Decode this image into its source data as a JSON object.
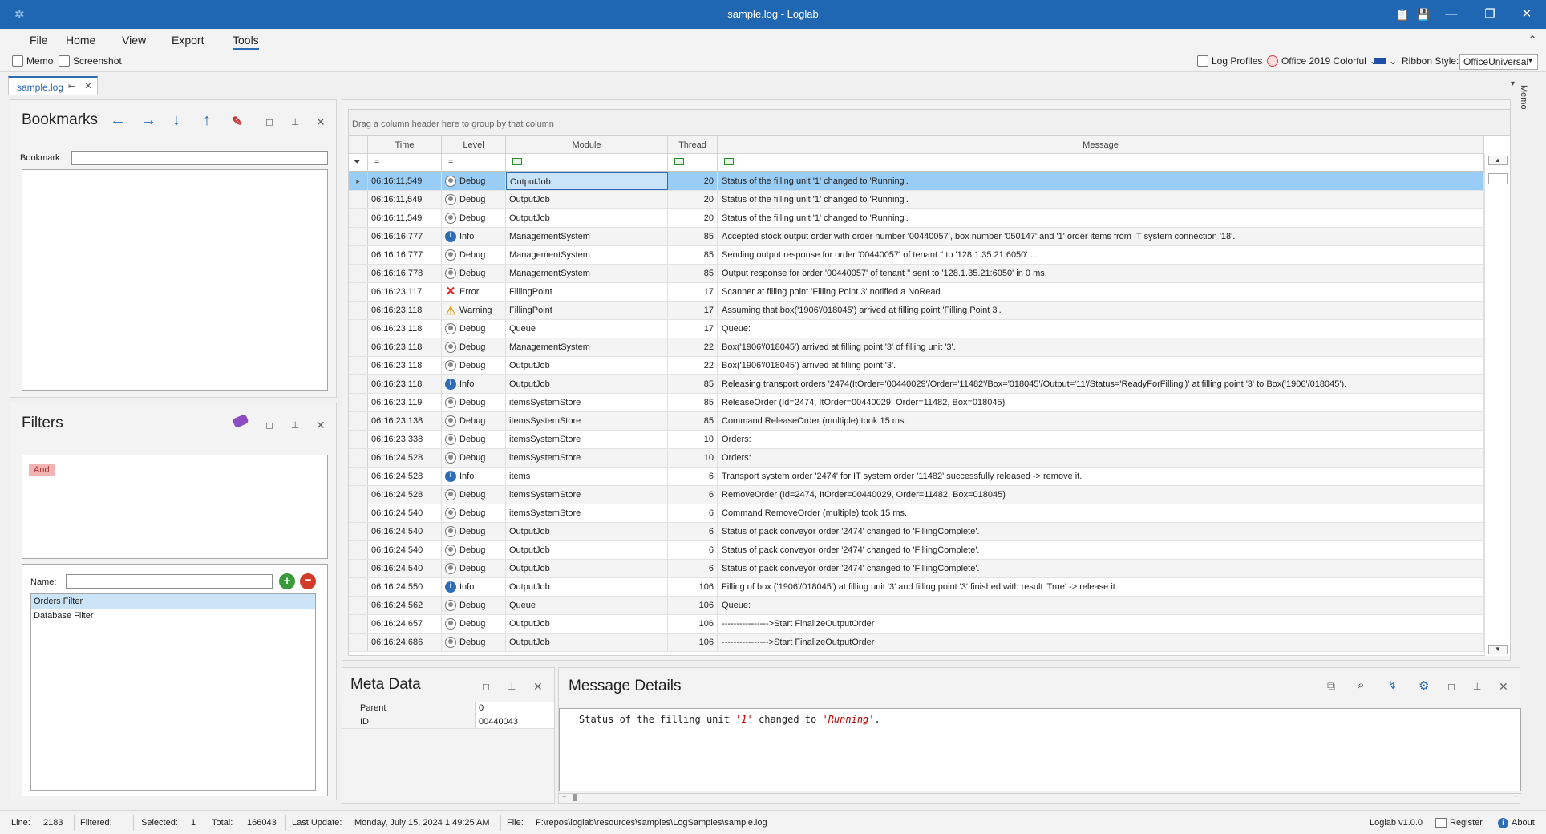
{
  "window": {
    "title": "sample.log - Loglab",
    "controls": {
      "minimize": "—",
      "maximize": "❐",
      "close": "✕"
    }
  },
  "menu": {
    "items": [
      "File",
      "Home",
      "View",
      "Export",
      "Tools"
    ],
    "active": "Tools"
  },
  "ribbon": {
    "memo_label": "Memo",
    "screenshot_label": "Screenshot",
    "log_profiles_label": "Log Profiles",
    "theme_label": "Office 2019 Colorful",
    "ribbon_style_label": "Ribbon Style:",
    "ribbon_style_value": "OfficeUniversal"
  },
  "doc_tab": {
    "label": "sample.log",
    "side_label": "Memo"
  },
  "bookmarks": {
    "title": "Bookmarks",
    "bookmark_label": "Bookmark:",
    "bookmark_value": ""
  },
  "filters": {
    "title": "Filters",
    "root_node": "And",
    "name_label": "Name:",
    "name_value": "",
    "list": [
      "Orders Filter",
      "Database Filter"
    ],
    "selected": "Orders Filter"
  },
  "grid": {
    "group_hint": "Drag a column header here to group by that column",
    "columns": [
      "Time",
      "Level",
      "Module",
      "Thread",
      "Message"
    ],
    "filter_ops": [
      "=",
      "="
    ],
    "rows": [
      {
        "time": "06:16:11,549",
        "level": "Debug",
        "module": "OutputJob",
        "thread": "20",
        "message": "Status of the filling unit '1' changed to 'Running'."
      },
      {
        "time": "06:16:11,549",
        "level": "Debug",
        "module": "OutputJob",
        "thread": "20",
        "message": "Status of the filling unit '1' changed to 'Running'."
      },
      {
        "time": "06:16:11,549",
        "level": "Debug",
        "module": "OutputJob",
        "thread": "20",
        "message": "Status of the filling unit '1' changed to 'Running'."
      },
      {
        "time": "06:16:16,777",
        "level": "Info",
        "module": "ManagementSystem",
        "thread": "85",
        "message": "Accepted stock output order with order number '00440057', box number '050147' and '1' order items from IT system connection '18'."
      },
      {
        "time": "06:16:16,777",
        "level": "Debug",
        "module": "ManagementSystem",
        "thread": "85",
        "message": "Sending output response for order '00440057' of tenant '' to '128.1.35.21:6050' ..."
      },
      {
        "time": "06:16:16,778",
        "level": "Debug",
        "module": "ManagementSystem",
        "thread": "85",
        "message": "Output response for order '00440057' of tenant '' sent to '128.1.35.21:6050' in 0 ms."
      },
      {
        "time": "06:16:23,117",
        "level": "Error",
        "module": "FillingPoint",
        "thread": "17",
        "message": "Scanner at filling point 'Filling Point 3' notified a NoRead."
      },
      {
        "time": "06:16:23,118",
        "level": "Warning",
        "module": "FillingPoint",
        "thread": "17",
        "message": "Assuming that box('1906'/018045') arrived at filling point 'Filling Point 3'."
      },
      {
        "time": "06:16:23,118",
        "level": "Debug",
        "module": "Queue",
        "thread": "17",
        "message": "Queue:"
      },
      {
        "time": "06:16:23,118",
        "level": "Debug",
        "module": "ManagementSystem",
        "thread": "22",
        "message": "Box('1906'/018045') arrived at filling point '3' of filling unit '3'."
      },
      {
        "time": "06:16:23,118",
        "level": "Debug",
        "module": "OutputJob",
        "thread": "22",
        "message": "Box('1906'/018045') arrived at filling point '3'."
      },
      {
        "time": "06:16:23,118",
        "level": "Info",
        "module": "OutputJob",
        "thread": "85",
        "message": "Releasing transport orders '2474(ItOrder='00440029'/Order='11482'/Box='018045'/Output='11'/Status='ReadyForFilling')' at filling point '3' to Box('1906'/018045')."
      },
      {
        "time": "06:16:23,119",
        "level": "Debug",
        "module": "itemsSystemStore",
        "thread": "85",
        "message": "ReleaseOrder (Id=2474, ItOrder=00440029, Order=11482, Box=018045)"
      },
      {
        "time": "06:16:23,138",
        "level": "Debug",
        "module": "itemsSystemStore",
        "thread": "85",
        "message": "Command ReleaseOrder (multiple) took 15 ms."
      },
      {
        "time": "06:16:23,338",
        "level": "Debug",
        "module": "itemsSystemStore",
        "thread": "10",
        "message": "Orders:"
      },
      {
        "time": "06:16:24,528",
        "level": "Debug",
        "module": "itemsSystemStore",
        "thread": "10",
        "message": "Orders:"
      },
      {
        "time": "06:16:24,528",
        "level": "Info",
        "module": "items",
        "thread": "6",
        "message": "Transport system order '2474' for IT system order '11482' successfully released -> remove it."
      },
      {
        "time": "06:16:24,528",
        "level": "Debug",
        "module": "itemsSystemStore",
        "thread": "6",
        "message": "RemoveOrder (Id=2474, ItOrder=00440029, Order=11482, Box=018045)"
      },
      {
        "time": "06:16:24,540",
        "level": "Debug",
        "module": "itemsSystemStore",
        "thread": "6",
        "message": "Command RemoveOrder (multiple) took 15 ms."
      },
      {
        "time": "06:16:24,540",
        "level": "Debug",
        "module": "OutputJob",
        "thread": "6",
        "message": "Status of pack conveyor order '2474' changed to 'FillingComplete'."
      },
      {
        "time": "06:16:24,540",
        "level": "Debug",
        "module": "OutputJob",
        "thread": "6",
        "message": "Status of pack conveyor order '2474' changed to 'FillingComplete'."
      },
      {
        "time": "06:16:24,540",
        "level": "Debug",
        "module": "OutputJob",
        "thread": "6",
        "message": "Status of pack conveyor order '2474' changed to 'FillingComplete'."
      },
      {
        "time": "06:16:24,550",
        "level": "Info",
        "module": "OutputJob",
        "thread": "106",
        "message": "Filling of box ('1906'/018045') at filling unit '3' and filling point '3' finished with result 'True' -> release it."
      },
      {
        "time": "06:16:24,562",
        "level": "Debug",
        "module": "Queue",
        "thread": "106",
        "message": "Queue:"
      },
      {
        "time": "06:16:24,657",
        "level": "Debug",
        "module": "OutputJob",
        "thread": "106",
        "message": "---------------->Start FinalizeOutputOrder"
      },
      {
        "time": "06:16:24,686",
        "level": "Debug",
        "module": "OutputJob",
        "thread": "106",
        "message": "---------------->Start FinalizeOutputOrder"
      }
    ]
  },
  "meta_data": {
    "title": "Meta Data",
    "rows": [
      {
        "key": "Parent",
        "value": "0"
      },
      {
        "key": "ID",
        "value": "00440043"
      }
    ]
  },
  "message_details": {
    "title": "Message Details",
    "text_prefix": "Status of the filling unit ",
    "quoted_1": "'1'",
    "text_mid": " changed to ",
    "quoted_2": "'Running'",
    "text_suffix": "."
  },
  "status": {
    "line_label": "Line:",
    "line_value": "2183",
    "filtered_label": "Filtered:",
    "filtered_value": "",
    "selected_label": "Selected:",
    "selected_value": "1",
    "total_label": "Total:",
    "total_value": "166043",
    "last_update_label": "Last Update:",
    "last_update_value": "Monday, July 15, 2024 1:49:25 AM",
    "file_label": "File:",
    "file_value": "F:\\repos\\loglab\\resources\\samples\\LogSamples\\sample.log",
    "version": "Loglab v1.0.0",
    "register_label": "Register",
    "about_label": "About"
  },
  "colors": {
    "accent": "#1f66b3",
    "selection": "#99cdf5",
    "error": "#d22222",
    "warning": "#e0a000",
    "string_literal": "#c00000"
  }
}
